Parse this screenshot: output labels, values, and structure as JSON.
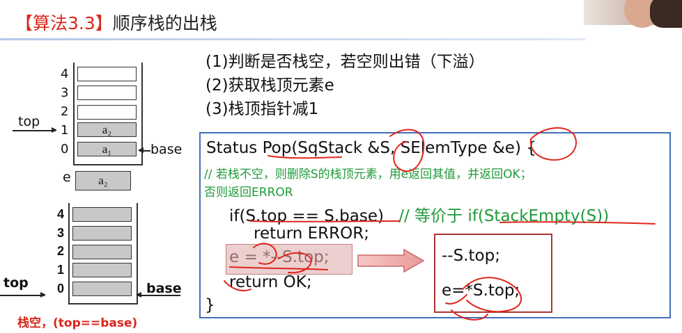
{
  "title": {
    "bracket": "【算法3.3】",
    "text": "顺序栈的出栈"
  },
  "steps": [
    "(1)判断是否栈空，若空则出错（下溢）",
    "(2)获取栈顶元素e",
    "(3)栈顶指针减1"
  ],
  "stack1": {
    "indices": [
      "4",
      "3",
      "2",
      "1",
      "0"
    ],
    "cells": [
      "a₂",
      "a₁"
    ],
    "top_label": "top",
    "base_label": "base",
    "e_label": "e",
    "e_value": "a₂"
  },
  "stack2": {
    "indices": [
      "4",
      "3",
      "2",
      "1",
      "0"
    ],
    "top_label": "top",
    "base_label": "base",
    "note": "栈空，(top==base)"
  },
  "code": {
    "signature": "Status Pop(SqStack &S, SElemType &e) {",
    "comment1": "// 若栈不空，则删除S的栈顶元素，用e返回其值，并返回OK；",
    "comment2": "否则返回ERROR",
    "if_line": "if(S.top == S.base)",
    "if_comment": "// 等价于 if(StackEmpty(S))",
    "return_error": "return ERROR;",
    "assign": "e = *--S.top;",
    "return_ok": "return OK;",
    "close": "}"
  },
  "result": {
    "line1": "--S.top;",
    "line2": "e=*S.top;"
  },
  "colors": {
    "accent_red": "#d9261c",
    "comment_green": "#1f9a3a",
    "box_blue": "#3f6fb8",
    "cell_gray": "#c8c8c8"
  }
}
